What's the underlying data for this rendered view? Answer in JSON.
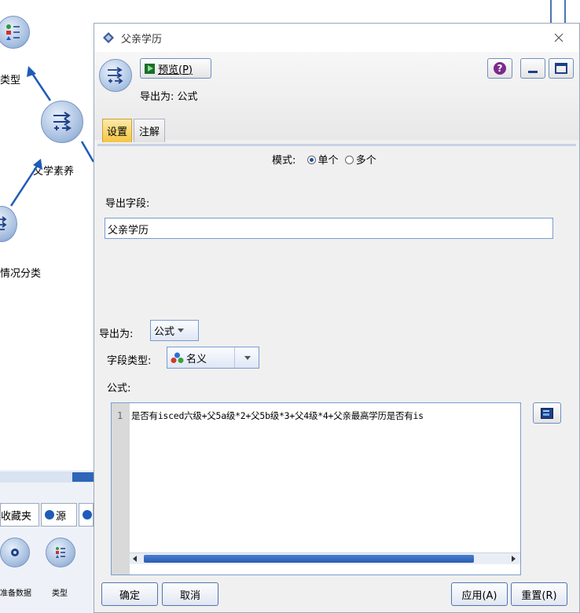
{
  "background": {
    "node_labels": [
      "类型",
      "父学素养",
      "情况分类"
    ],
    "palette_tabs": [
      "收藏夹",
      "源"
    ],
    "palette_items": [
      "准备数据",
      "类型"
    ]
  },
  "dialog": {
    "title": "父亲学历",
    "preview_label": "预览(P)",
    "export_as_header": "导出为: 公式",
    "tabs": [
      {
        "label": "设置",
        "active": true
      },
      {
        "label": "注解",
        "active": false
      }
    ],
    "mode": {
      "label": "模式:",
      "options": [
        "单个",
        "多个"
      ],
      "selected": "单个"
    },
    "derive_field": {
      "label": "导出字段:",
      "value": "父亲学历"
    },
    "derive_as": {
      "label": "导出为:",
      "value": "公式"
    },
    "field_type": {
      "label": "字段类型:",
      "value": "名义"
    },
    "formula": {
      "label": "公式:",
      "line_number": "1",
      "text": "是否有isced六级+父5a级*2+父5b级*3+父4级*4+父亲最高学历是否有is"
    },
    "buttons": {
      "ok": "确定",
      "cancel": "取消",
      "apply": "应用(A)",
      "reset": "重置(R)"
    },
    "help_glyph": "?"
  },
  "colors": {
    "accent": "#1e5bb8",
    "tab_active": "#f5c542",
    "border": "#7a9ccf"
  }
}
